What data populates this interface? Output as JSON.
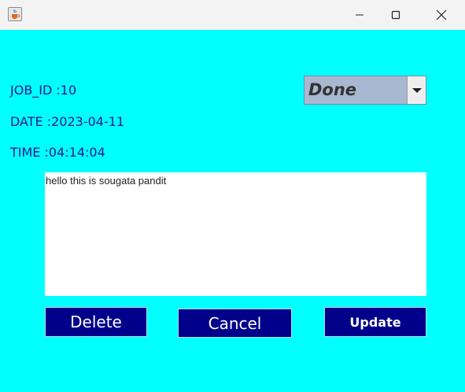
{
  "job": {
    "id_label": "JOB_ID :10",
    "date_label": "DATE :2023-04-11",
    "time_label": "TIME :04:14:04"
  },
  "status": {
    "selected": "Done"
  },
  "description": {
    "text": "hello this is sougata pandit"
  },
  "buttons": {
    "delete": "Delete",
    "cancel": "Cancel",
    "update": "Update"
  },
  "icons": {
    "app": "java-cup-icon",
    "minimize": "minimize-icon",
    "maximize": "maximize-icon",
    "close": "close-icon",
    "dropdown": "dropdown-arrow-icon"
  },
  "colors": {
    "background": "#00ffff",
    "label_text": "#1a1a8c",
    "button_bg": "#00008b",
    "button_text": "#ffffff"
  }
}
